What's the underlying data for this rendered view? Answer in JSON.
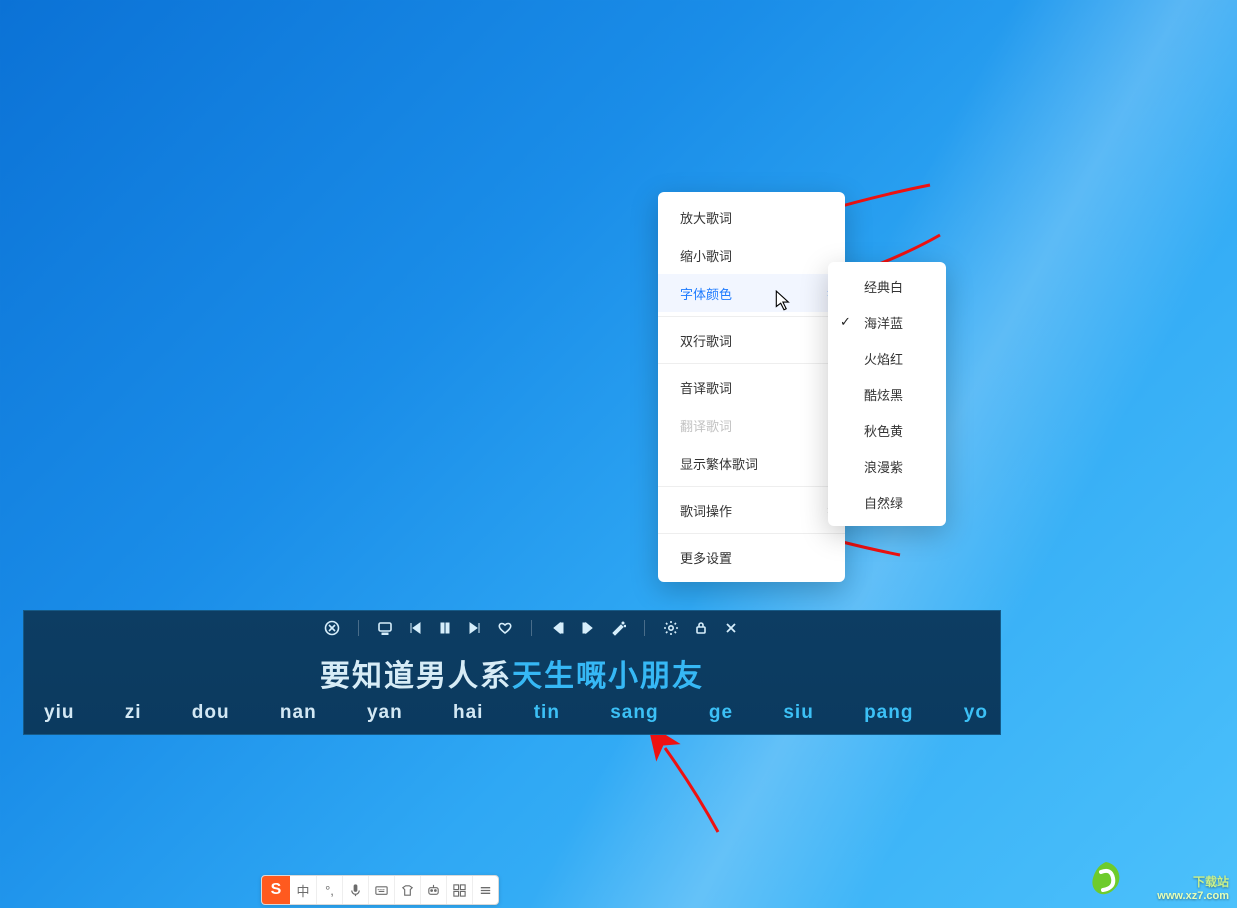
{
  "menu": {
    "items": {
      "enlarge": "放大歌词",
      "shrink": "缩小歌词",
      "fontcolor": "字体颜色",
      "twoline": "双行歌词",
      "translit": "音译歌词",
      "translate": "翻译歌词",
      "trad": "显示繁体歌词",
      "ops": "歌词操作",
      "more": "更多设置"
    }
  },
  "submenu": {
    "items": {
      "white": "经典白",
      "blue": "海洋蓝",
      "red": "火焰红",
      "black": "酷炫黑",
      "yellow": "秋色黄",
      "purple": "浪漫紫",
      "green": "自然绿"
    },
    "checked": "blue"
  },
  "lyrics": {
    "sung": "要知道男人系",
    "ahead": "天生嘅小朋友",
    "pinyin": [
      {
        "t": "yiu",
        "s": true
      },
      {
        "t": "zi",
        "s": true
      },
      {
        "t": "dou",
        "s": true
      },
      {
        "t": "nan",
        "s": true
      },
      {
        "t": "yan",
        "s": true
      },
      {
        "t": "hai",
        "s": true
      },
      {
        "t": "tin",
        "s": false
      },
      {
        "t": "sang",
        "s": false
      },
      {
        "t": "ge",
        "s": false
      },
      {
        "t": "siu",
        "s": false
      },
      {
        "t": "pang",
        "s": false
      },
      {
        "t": "yo",
        "s": false
      }
    ]
  },
  "ime": {
    "logo": "S",
    "lang": "中"
  },
  "watermark": {
    "line1": "下载站",
    "line2": "www.xz7.com"
  }
}
